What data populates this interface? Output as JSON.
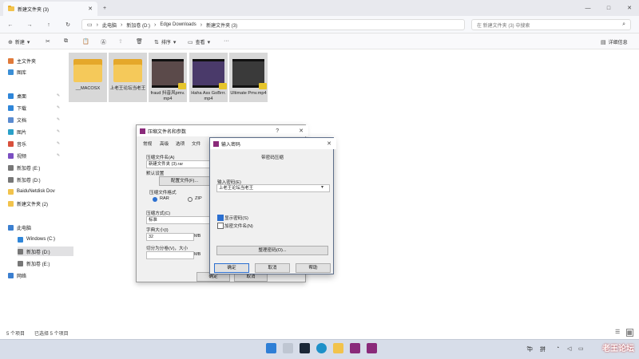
{
  "window": {
    "tab_title": "新建文件夹 (3)",
    "new_tab": "+",
    "controls": {
      "minimize": "—",
      "maximize": "□",
      "close": "✕"
    }
  },
  "nav": {
    "back": "←",
    "forward": "→",
    "up": "↑",
    "refresh": "↻"
  },
  "breadcrumb": [
    "此电脑",
    "新加卷 (D:)",
    "Edge Downloads",
    "新建文件夹 (3)"
  ],
  "search": {
    "placeholder": "在 新建文件夹 (3) 中搜索"
  },
  "toolbar": {
    "new_label": "新建",
    "sort_label": "排序",
    "view_label": "查看",
    "more": "···",
    "details_label": "详细信息"
  },
  "sidebar": {
    "items": [
      {
        "label": "主文件夹",
        "color": "#e07a3a"
      },
      {
        "label": "图库",
        "color": "#3b8fd6"
      },
      {
        "label": "桌面",
        "color": "#2f86d9",
        "pinned": true
      },
      {
        "label": "下载",
        "color": "#2f86d9",
        "pinned": true
      },
      {
        "label": "文档",
        "color": "#5a8bd0",
        "pinned": true
      },
      {
        "label": "图片",
        "color": "#2aa0c8",
        "pinned": true
      },
      {
        "label": "音乐",
        "color": "#d8503c",
        "pinned": true
      },
      {
        "label": "视频",
        "color": "#7b4fc2",
        "pinned": true
      },
      {
        "label": "新加卷 (E:)",
        "color": "#777777"
      },
      {
        "label": "新加卷 (D:)",
        "color": "#777777"
      },
      {
        "label": "BaiduNetdisk Dov",
        "color": "#f2c34c"
      },
      {
        "label": "新建文件夹 (2)",
        "color": "#f2c34c"
      },
      {
        "label": "此电脑",
        "color": "#3b7fd0"
      },
      {
        "label": "Windows (C:)",
        "color": "#2f86d9"
      },
      {
        "label": "新加卷 (D:)",
        "color": "#777777"
      },
      {
        "label": "新加卷 (E:)",
        "color": "#777777"
      },
      {
        "label": "网络",
        "color": "#3b7fd0"
      }
    ],
    "pin_glyph": "✎"
  },
  "files": [
    {
      "name": "__MACOSX",
      "type": "folder"
    },
    {
      "name": "上老王论坛当老王",
      "type": "folder"
    },
    {
      "name": "fraud 抖音风pmv.mp4",
      "type": "video",
      "color": "#5b4a4a"
    },
    {
      "name": "Haha Ass GoBrrr.mp4",
      "type": "video",
      "color": "#4a3a6a"
    },
    {
      "name": "Ultimate Pmv.mp4",
      "type": "video",
      "color": "#3a3a3a"
    }
  ],
  "status": {
    "count": "5 个项目",
    "selected": "已选择 5 个项目"
  },
  "archive_dialog": {
    "title": "压缩文件名和参数",
    "help_glyph": "?",
    "close_glyph": "✕",
    "tabs": [
      "常规",
      "高级",
      "选项",
      "文件"
    ],
    "name_label": "压缩文件名(A)",
    "name_value": "新建文件夹 (3).rar",
    "default_label": "默认设置",
    "profile_button": "配置文件(F)...",
    "format_label": "压缩文件格式",
    "format_rar": "RAR",
    "format_zip": "ZIP",
    "method_label": "压缩方式(C)",
    "method_value": "标准",
    "dict_label": "字典大小(I)",
    "dict_value": "32",
    "dict_unit": "MB",
    "split_label": "切分为分卷(V)，大小",
    "split_unit": "MB",
    "ok_button": "确定",
    "cancel_button": "取消"
  },
  "password_dialog": {
    "title": "输入密码",
    "close_glyph": "✕",
    "subtitle": "带密码压缩",
    "input_label": "输入密码(E)",
    "input_value": "上老王论坛当老王",
    "show_password": "显示密码(S)",
    "encrypt_names": "加密文件名(N)",
    "manage_button": "整理密码(O)...",
    "ok_button": "确定",
    "cancel_button": "取消",
    "help_button": "帮助"
  },
  "taskbar": {
    "lang": "中",
    "ime": "拼",
    "watermark": "老王论坛"
  }
}
